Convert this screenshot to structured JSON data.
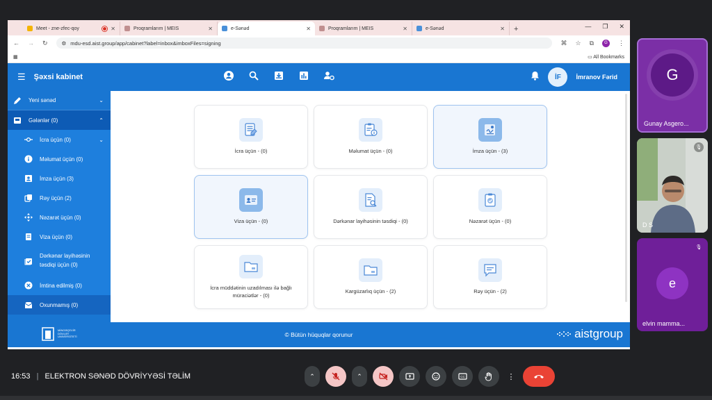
{
  "browser": {
    "tabs": [
      {
        "label": "Meet - zne-zfec-qoy",
        "color": "#f4b400",
        "recording": true
      },
      {
        "label": "Proqramlarım | MEIS",
        "color": "#c08f8f"
      },
      {
        "label": "e-Sənəd",
        "color": "#4a90d9",
        "active": true
      },
      {
        "label": "Proqramlarım | MEIS",
        "color": "#c08f8f"
      },
      {
        "label": "e-Sənəd",
        "color": "#4a90d9"
      }
    ],
    "url": "mdu-esd.aist.group/app/cabinet?label=inbox&imboxFiles=signing",
    "profile_initial": "G",
    "bookmarks_label": "All Bookmarks"
  },
  "app": {
    "title": "Şəxsi kabinet",
    "user_initials": "İF",
    "user_name": "İmranov Fərid"
  },
  "sidebar": {
    "items": [
      {
        "label": "Yeni sənəd",
        "icon": "pencil-icon"
      },
      {
        "label": "Gələnlər (0)",
        "icon": "inbox-icon"
      }
    ],
    "subitems": [
      {
        "label": "İcra üçün (0)",
        "icon": "commit-icon"
      },
      {
        "label": "Məlumat üçün (0)",
        "icon": "info-icon"
      },
      {
        "label": "İmza üçün (3)",
        "icon": "id-badge-icon"
      },
      {
        "label": "Rəy üçün (2)",
        "icon": "copy-icon"
      },
      {
        "label": "Nəzarət üçün (0)",
        "icon": "move-icon"
      },
      {
        "label": "Viza üçün (0)",
        "icon": "document-icon"
      },
      {
        "label": "Dərkənar layihəsinin təsdiqi üçün (0)",
        "icon": "check-box-icon"
      },
      {
        "label": "İmtina edilmiş (0)",
        "icon": "cancel-icon"
      },
      {
        "label": "Oxunmamış (0)",
        "icon": "envelope-icon"
      }
    ]
  },
  "cards": [
    {
      "label": "İcra üçün - (0)",
      "icon": "document-list-icon"
    },
    {
      "label": "Məlumat üçün - (0)",
      "icon": "clipboard-info-icon"
    },
    {
      "label": "İmza üçün - (3)",
      "icon": "signature-icon"
    },
    {
      "label": "Viza üçün - (0)",
      "icon": "id-card-icon"
    },
    {
      "label": "Dərkənar layihəsinin təsdiqi - (0)",
      "icon": "document-search-icon"
    },
    {
      "label": "Nəzarət üçün - (0)",
      "icon": "clipboard-check-icon"
    },
    {
      "label": "İcra müddətinin uzadılması ilə bağlı müraciətlər - (0)",
      "icon": "folder-icon"
    },
    {
      "label": "Kargüzarlıq üçün - (2)",
      "icon": "folder-icon"
    },
    {
      "label": "Rəy üçün - (2)",
      "icon": "chat-icon"
    }
  ],
  "footer": {
    "copyright": "©  Bütün hüquqlar qorunur",
    "brand": "aistgroup",
    "logo_text": "MİNGƏÇEVİR DÖVLƏT UNİVERSİTETİ"
  },
  "meet": {
    "participants": [
      {
        "name": "Gunay Asgero...",
        "initial": "G"
      },
      {
        "name": "D S"
      },
      {
        "name": "elvin mamma...",
        "initial": "e"
      }
    ],
    "time": "16:53",
    "meeting_title": "ELEKTRON SƏNƏD DÖVRİYYƏSİ TƏLİM"
  },
  "colors": {
    "primary": "#1976d2",
    "end_call": "#ea4335"
  }
}
